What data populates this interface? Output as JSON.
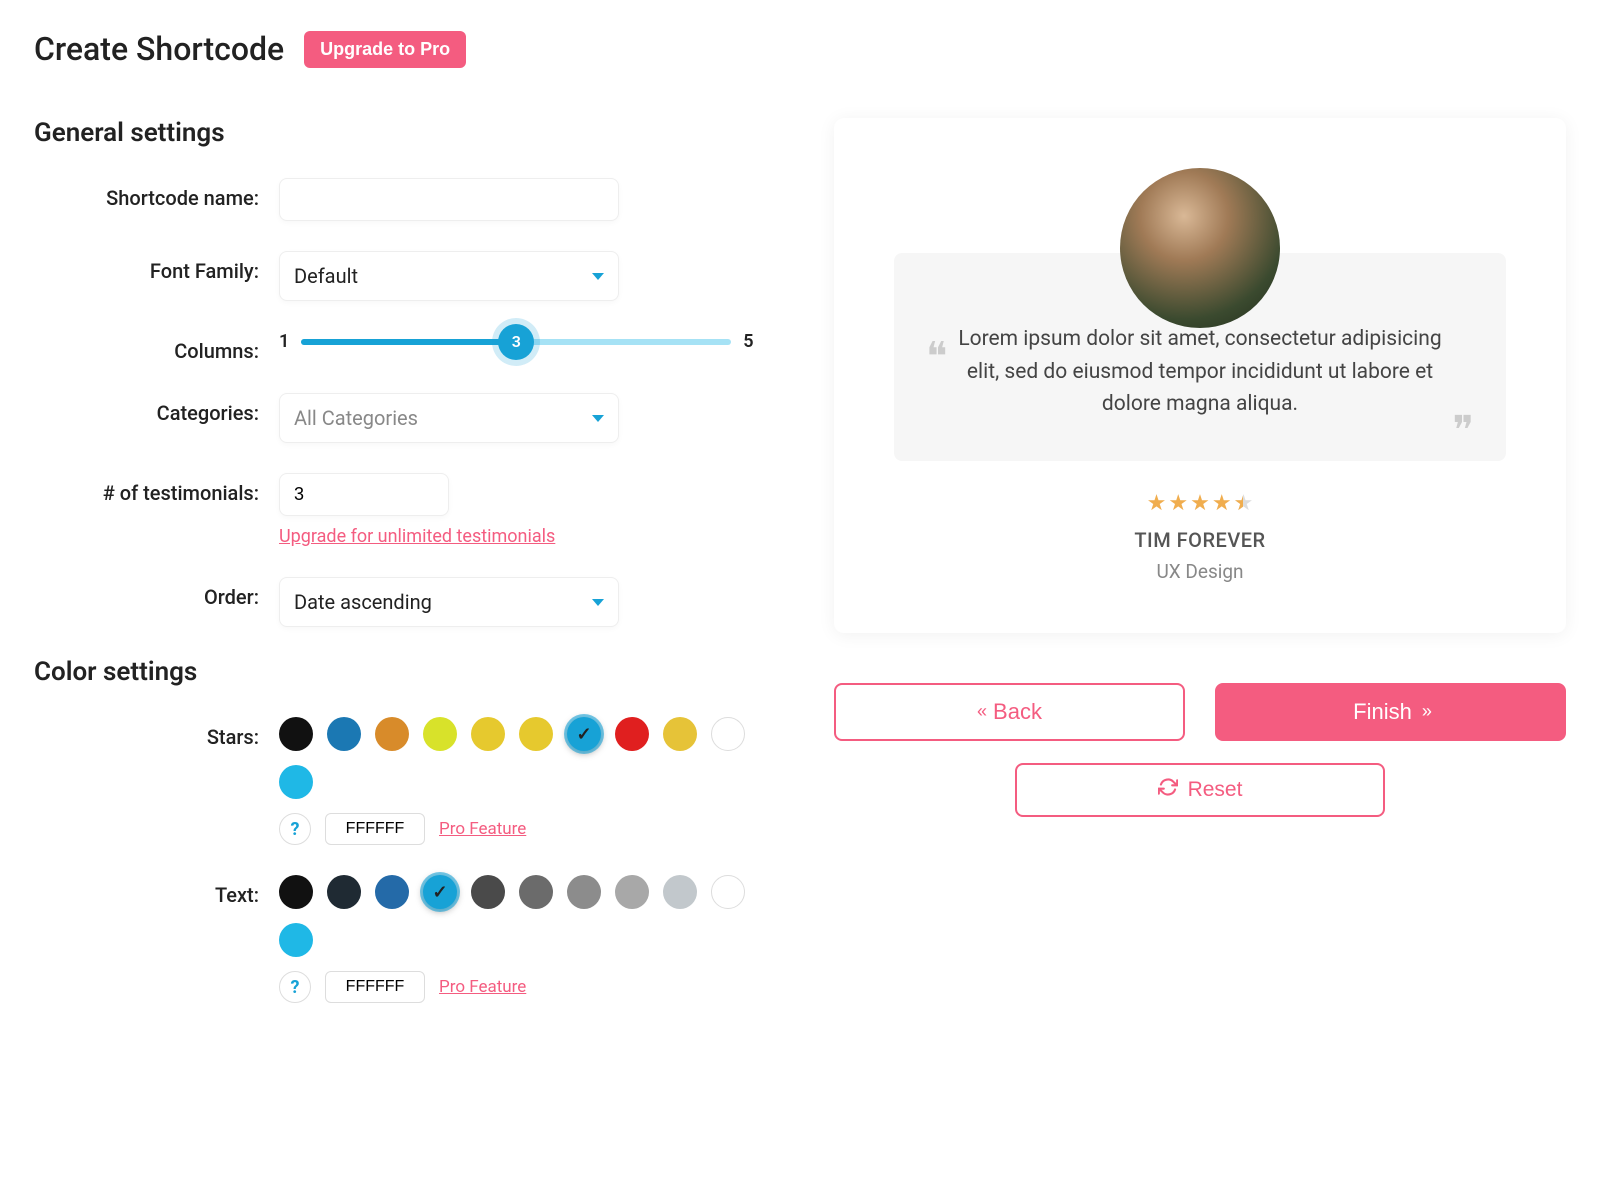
{
  "header": {
    "title": "Create Shortcode",
    "upgrade": "Upgrade to Pro"
  },
  "general": {
    "heading": "General settings",
    "name_label": "Shortcode name:",
    "name_value": "",
    "font_label": "Font Family:",
    "font_value": "Default",
    "columns_label": "Columns:",
    "columns_min": "1",
    "columns_max": "5",
    "columns_value": "3",
    "categories_label": "Categories:",
    "categories_value": "All Categories",
    "testimonials_label": "# of testimonials:",
    "testimonials_value": "3",
    "testimonials_help": "Upgrade for unlimited testimonials",
    "order_label": "Order:",
    "order_value": "Date ascending"
  },
  "color": {
    "heading": "Color settings",
    "stars_label": "Stars:",
    "stars_swatches": [
      "#111111",
      "#1b78b3",
      "#d88b2a",
      "#d8e22a",
      "#e6c92e",
      "#e6c92e",
      "#17a2d6",
      "#e01f1f",
      "#e6c338",
      "#ffffff",
      "#1fb8e6"
    ],
    "stars_selected_index": 6,
    "stars_hex": "FFFFFF",
    "text_label": "Text:",
    "text_swatches": [
      "#111111",
      "#1f2a33",
      "#246aa8",
      "#17a2d6",
      "#4a4a4a",
      "#6b6b6b",
      "#8c8c8c",
      "#a8a8a8",
      "#c2c8cc",
      "#ffffff",
      "#1fb8e6"
    ],
    "text_selected_index": 3,
    "text_hex": "FFFFFF",
    "help_q": "?",
    "pro_feature": "Pro Feature"
  },
  "preview": {
    "quote": "Lorem ipsum dolor sit amet, consectetur adipisicing elit, sed do eiusmod tempor incididunt ut labore et dolore magna aliqua.",
    "stars": 4.5,
    "author": "TIM FOREVER",
    "role": "UX Design"
  },
  "actions": {
    "back": "Back",
    "finish": "Finish",
    "reset": "Reset"
  }
}
